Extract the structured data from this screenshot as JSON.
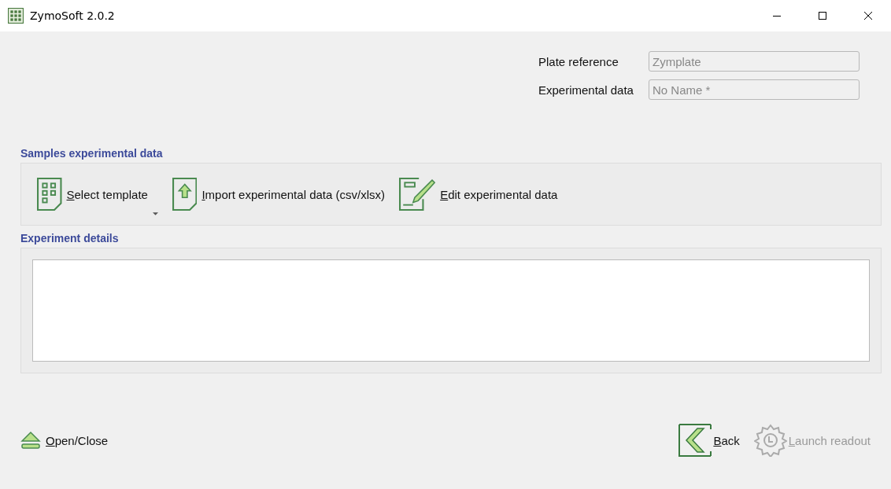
{
  "window": {
    "title": "ZymoSoft 2.0.2"
  },
  "fields": [
    {
      "label": "Plate reference",
      "value": "Zymplate"
    },
    {
      "label": "Experimental data",
      "value": "No Name *"
    }
  ],
  "samples": {
    "title": "Samples experimental data",
    "buttons": [
      {
        "kind": "template",
        "label": "Select template",
        "dropdown": true
      },
      {
        "kind": "import",
        "label": "Import experimental data (csv/xlsx)",
        "dropdown": false
      },
      {
        "kind": "edit",
        "label": "Edit experimental data",
        "dropdown": false
      }
    ]
  },
  "details": {
    "title": "Experiment details"
  },
  "footer": {
    "left": {
      "kind": "eject",
      "label": "Open/Close",
      "disabled": false
    },
    "right": [
      {
        "kind": "back",
        "label": "Back",
        "disabled": false
      },
      {
        "kind": "launch",
        "label": "Launch readout",
        "disabled": true
      }
    ]
  }
}
